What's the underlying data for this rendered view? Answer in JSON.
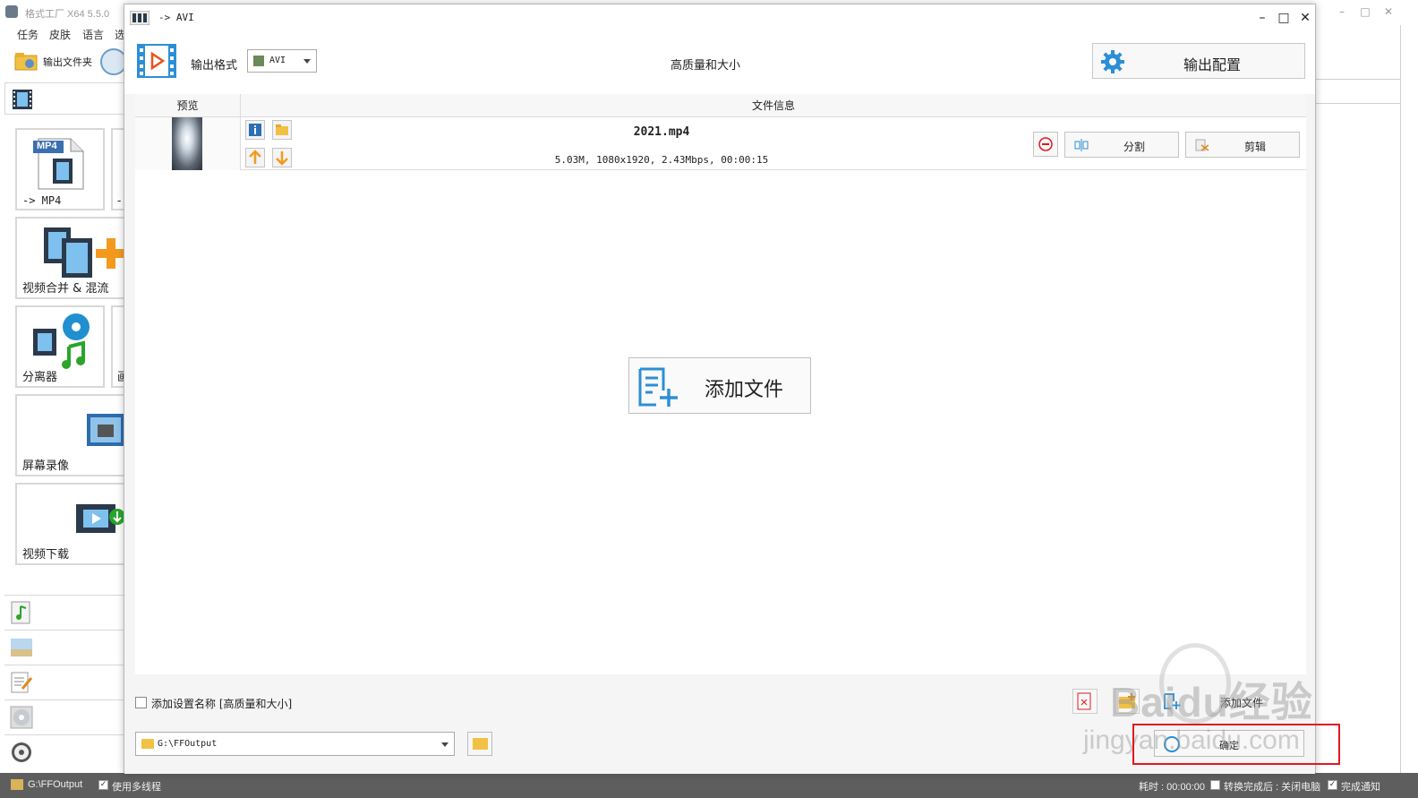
{
  "main_window": {
    "title": "格式工厂 X64 5.5.0",
    "menu": [
      "任务",
      "皮肤",
      "语言",
      "选"
    ],
    "output_folder_label": "输出文件夹",
    "tiles": [
      {
        "label": "-> MP4"
      },
      {
        "label": "视频合并 & 混流"
      },
      {
        "label": "分离器"
      },
      {
        "label": "屏幕录像"
      },
      {
        "label": "视频下载"
      }
    ],
    "partial_tiles": [
      "-",
      "画"
    ],
    "tile_badge": "MP4",
    "categories": [
      "audio-icon",
      "image-icon",
      "document-icon",
      "disc-icon",
      "utilities-icon"
    ]
  },
  "dialog": {
    "title": "-> AVI",
    "format_label": "输出格式",
    "format_value": "AVI",
    "quality": "高质量和大小",
    "config_button": "输出配置",
    "columns": {
      "preview": "预览",
      "info": "文件信息"
    },
    "files": [
      {
        "name": "2021.mp4",
        "info": "5.03M, 1080x1920, 2.43Mbps, 00:00:15"
      }
    ],
    "split_button": "分割",
    "clip_button": "剪辑",
    "add_file_button": "添加文件",
    "add_name_checkbox": "添加设置名称 [高质量和大小]",
    "output_path": "G:\\FFOutput",
    "add_file_small": "添加文件",
    "ok_button": "确定"
  },
  "statusbar": {
    "path": "G:\\FFOutput",
    "multithread": "使用多线程",
    "elapsed": "耗时 : 00:00:00",
    "after_convert": "转换完成后 : 关闭电脑",
    "notify": "完成通知"
  },
  "watermark": {
    "brand": "Baidu经验",
    "url": "jingyan.baidu.com"
  },
  "colors": {
    "accent_blue": "#2c8fd6",
    "highlight_red": "#e0191f",
    "status_bg": "#5e5e5e"
  }
}
